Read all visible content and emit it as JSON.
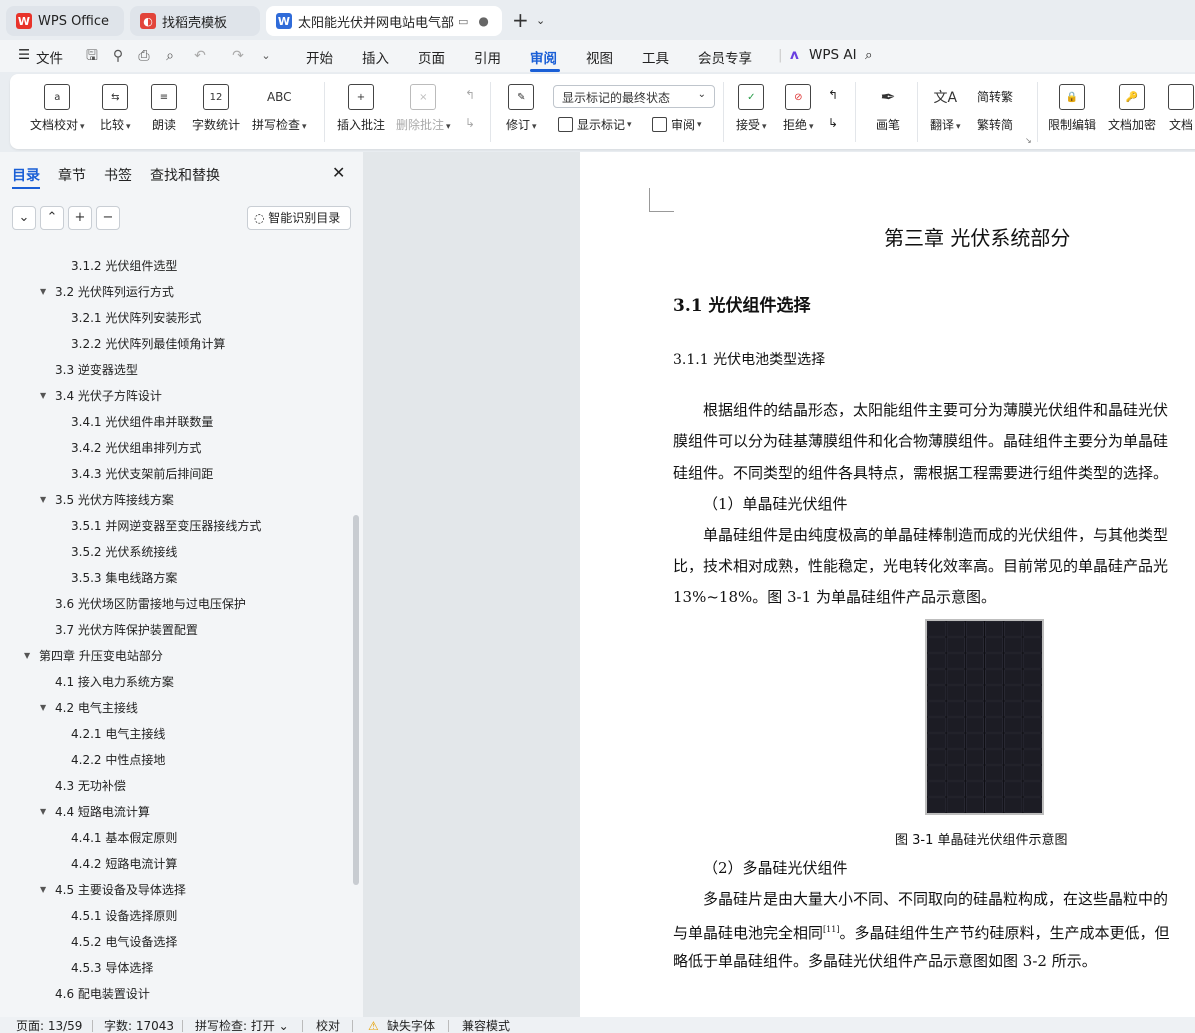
{
  "tabs": [
    {
      "label": "WPS Office",
      "icon": "wps-logo-icon",
      "color": "#e8332a"
    },
    {
      "label": "找稻壳模板",
      "icon": "docer-icon",
      "color": "#e2443a"
    },
    {
      "label": "太阳能光伏并网电站电气部分设",
      "icon": "word-doc-icon",
      "color": "#2f6bd9"
    }
  ],
  "menu": {
    "file": "文件",
    "items": [
      "开始",
      "插入",
      "页面",
      "引用",
      "审阅",
      "视图",
      "工具",
      "会员专享"
    ],
    "active": "审阅",
    "wps_ai": "WPS AI"
  },
  "ribbon": {
    "doc_proof": "文档校对",
    "compare": "比较",
    "read_aloud": "朗读",
    "word_count": "字数统计",
    "spell_check": "拼写检查",
    "insert_comment": "插入批注",
    "delete_comment": "删除批注",
    "track_changes": "修订",
    "markup_mode": "显示标记的最终状态",
    "show_markup": "显示标记",
    "review_pane": "审阅",
    "accept": "接受",
    "reject": "拒绝",
    "pen": "画笔",
    "translate": "翻译",
    "to_traditional": "简转繁",
    "to_simplified": "繁转简",
    "restrict_editing": "限制编辑",
    "encrypt": "文档加密",
    "doc_more": "文档"
  },
  "sidebar": {
    "tabs": [
      "目录",
      "章节",
      "书签",
      "查找和替换"
    ],
    "smart_toc": "智能识别目录",
    "toc": [
      {
        "text": "3.1.2  光伏组件选型",
        "level": 3,
        "expand": false
      },
      {
        "text": "3.2  光伏阵列运行方式",
        "level": 2,
        "expand": true
      },
      {
        "text": "3.2.1  光伏阵列安装形式",
        "level": 3,
        "expand": false
      },
      {
        "text": "3.2.2  光伏阵列最佳倾角计算",
        "level": 3,
        "expand": false
      },
      {
        "text": "3.3  逆变器选型",
        "level": 2,
        "expand": false
      },
      {
        "text": "3.4  光伏子方阵设计",
        "level": 2,
        "expand": true
      },
      {
        "text": "3.4.1  光伏组件串并联数量",
        "level": 3,
        "expand": false
      },
      {
        "text": "3.4.2  光伏组串排列方式",
        "level": 3,
        "expand": false
      },
      {
        "text": "3.4.3  光伏支架前后排间距",
        "level": 3,
        "expand": false
      },
      {
        "text": "3.5  光伏方阵接线方案",
        "level": 2,
        "expand": true
      },
      {
        "text": "3.5.1  并网逆变器至变压器接线方式",
        "level": 3,
        "expand": false
      },
      {
        "text": "3.5.2  光伏系统接线",
        "level": 3,
        "expand": false
      },
      {
        "text": "3.5.3  集电线路方案",
        "level": 3,
        "expand": false
      },
      {
        "text": "3.6  光伏场区防雷接地与过电压保护",
        "level": 2,
        "expand": false
      },
      {
        "text": "3.7  光伏方阵保护装置配置",
        "level": 2,
        "expand": false
      },
      {
        "text": "第四章  升压变电站部分",
        "level": 1,
        "expand": true
      },
      {
        "text": "4.1  接入电力系统方案",
        "level": 2,
        "expand": false
      },
      {
        "text": "4.2  电气主接线",
        "level": 2,
        "expand": true
      },
      {
        "text": "4.2.1  电气主接线",
        "level": 3,
        "expand": false
      },
      {
        "text": "4.2.2  中性点接地",
        "level": 3,
        "expand": false
      },
      {
        "text": "4.3  无功补偿",
        "level": 2,
        "expand": false
      },
      {
        "text": "4.4  短路电流计算",
        "level": 2,
        "expand": true
      },
      {
        "text": "4.4.1 基本假定原则",
        "level": 3,
        "expand": false
      },
      {
        "text": "4.4.2  短路电流计算",
        "level": 3,
        "expand": false
      },
      {
        "text": "4.5  主要设备及导体选择",
        "level": 2,
        "expand": true
      },
      {
        "text": "4.5.1  设备选择原则",
        "level": 3,
        "expand": false
      },
      {
        "text": "4.5.2  电气设备选择",
        "level": 3,
        "expand": false
      },
      {
        "text": "4.5.3  导体选择",
        "level": 3,
        "expand": false
      },
      {
        "text": "4.6  配电装置设计",
        "level": 2,
        "expand": false
      }
    ]
  },
  "document": {
    "chapter_title": "第三章  光伏系统部分",
    "section_title": "3.1 光伏组件选择",
    "subsection_title": "3.1.1 光伏电池类型选择",
    "paragraphs": [
      "根据组件的结晶形态，太阳能组件主要可分为薄膜光伏组件和晶硅光伏",
      "膜组件可以分为硅基薄膜组件和化合物薄膜组件。晶硅组件主要分为单晶硅",
      "硅组件。不同类型的组件各具特点，需根据工程需要进行组件类型的选择。",
      "（1）单晶硅光伏组件",
      "单晶硅组件是由纯度极高的单晶硅棒制造而成的光伏组件，与其他类型",
      "比，技术相对成熟，性能稳定，光电转化效率高。目前常见的单晶硅产品光",
      "13%~18%。图 3-1 为单晶硅组件产品示意图。"
    ],
    "figure_caption": "图 3-1 单晶硅光伏组件示意图",
    "paragraphs2": [
      "（2）多晶硅光伏组件",
      "多晶硅片是由大量大小不同、不同取向的硅晶粒构成，在这些晶粒中的",
      "与单晶硅电池完全相同",
      "[11]",
      "。多晶硅组件生产节约硅原料，生产成本更低，但",
      "略低于单晶硅组件。多晶硅光伏组件产品示意图如图 3-2 所示。"
    ]
  },
  "status": {
    "page": "页面: 13/59",
    "words": "字数: 17043",
    "spell": "拼写检查: 打开",
    "proof": "校对",
    "missing_font": "缺失字体",
    "compat": "兼容模式"
  }
}
